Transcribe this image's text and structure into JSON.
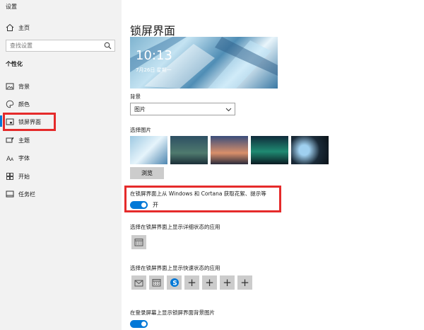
{
  "window": {
    "title": "设置"
  },
  "sidebar": {
    "home_label": "主页",
    "search_placeholder": "查找设置",
    "section_title": "个性化",
    "items": [
      {
        "label": "背景"
      },
      {
        "label": "颜色"
      },
      {
        "label": "锁屏界面"
      },
      {
        "label": "主题"
      },
      {
        "label": "字体"
      },
      {
        "label": "开始"
      },
      {
        "label": "任务栏"
      }
    ],
    "selected_index": 2
  },
  "main": {
    "title": "锁屏界面",
    "preview": {
      "time": "10:13",
      "date": "7月26日 星期一"
    },
    "background_label": "背景",
    "background_value": "图片",
    "choose_picture_label": "选择图片",
    "browse_label": "浏览",
    "fun_facts_label": "在锁屏界面上从 Windows 和 Cortana 获取花絮、提示等",
    "fun_facts_toggle_label": "开",
    "detailed_status_label": "选择在锁屏界面上显示详细状态的应用",
    "quick_status_label": "选择在锁屏界面上显示快速状态的应用",
    "signin_background_label": "在登录屏幕上显示锁屏界面背景图片"
  },
  "colors": {
    "accent": "#0078d7",
    "annotation_red": "#e52b2b"
  },
  "icons": {
    "home": "home-icon",
    "search": "search-icon",
    "background": "image-icon",
    "color": "palette-icon",
    "lockscreen": "lockscreen-icon",
    "themes": "themes-icon",
    "fonts": "font-icon",
    "start": "start-icon",
    "taskbar": "taskbar-icon"
  }
}
